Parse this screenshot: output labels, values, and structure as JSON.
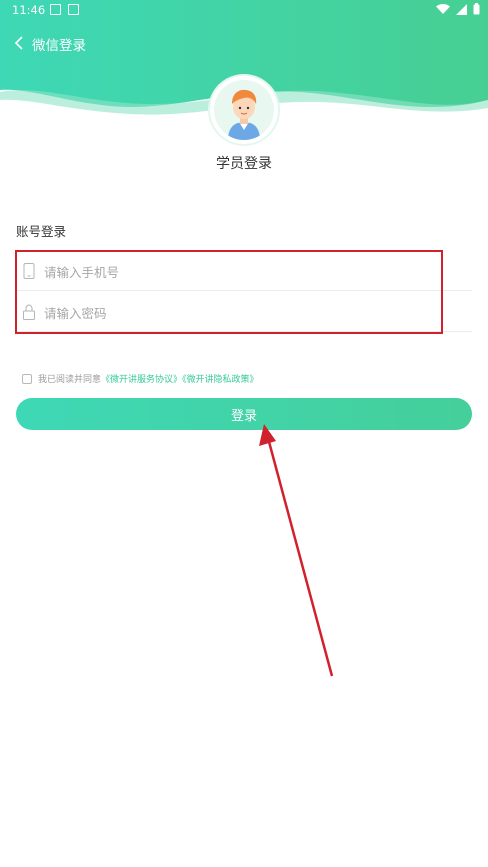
{
  "status_bar": {
    "time": "11:46"
  },
  "nav": {
    "title": "微信登录"
  },
  "profile": {
    "role_title": "学员登录"
  },
  "form": {
    "section_label": "账号登录",
    "phone_placeholder": "请输入手机号",
    "password_placeholder": "请输入密码"
  },
  "agreement": {
    "prefix": "我已阅读并同意",
    "service_link": "《微开讲服务协议》",
    "privacy_link": "《微开讲隐私政策》"
  },
  "login_button": {
    "label": "登录"
  },
  "colors": {
    "header_start": "#3ed8b6",
    "header_end": "#47cf93",
    "accent": "#35c99a",
    "annotation": "#d0222c"
  },
  "icons": [
    "back-arrow-icon",
    "image-icon",
    "a-icon",
    "wifi-icon",
    "signal-icon",
    "battery-icon",
    "phone-icon",
    "lock-icon",
    "checkbox-icon"
  ]
}
